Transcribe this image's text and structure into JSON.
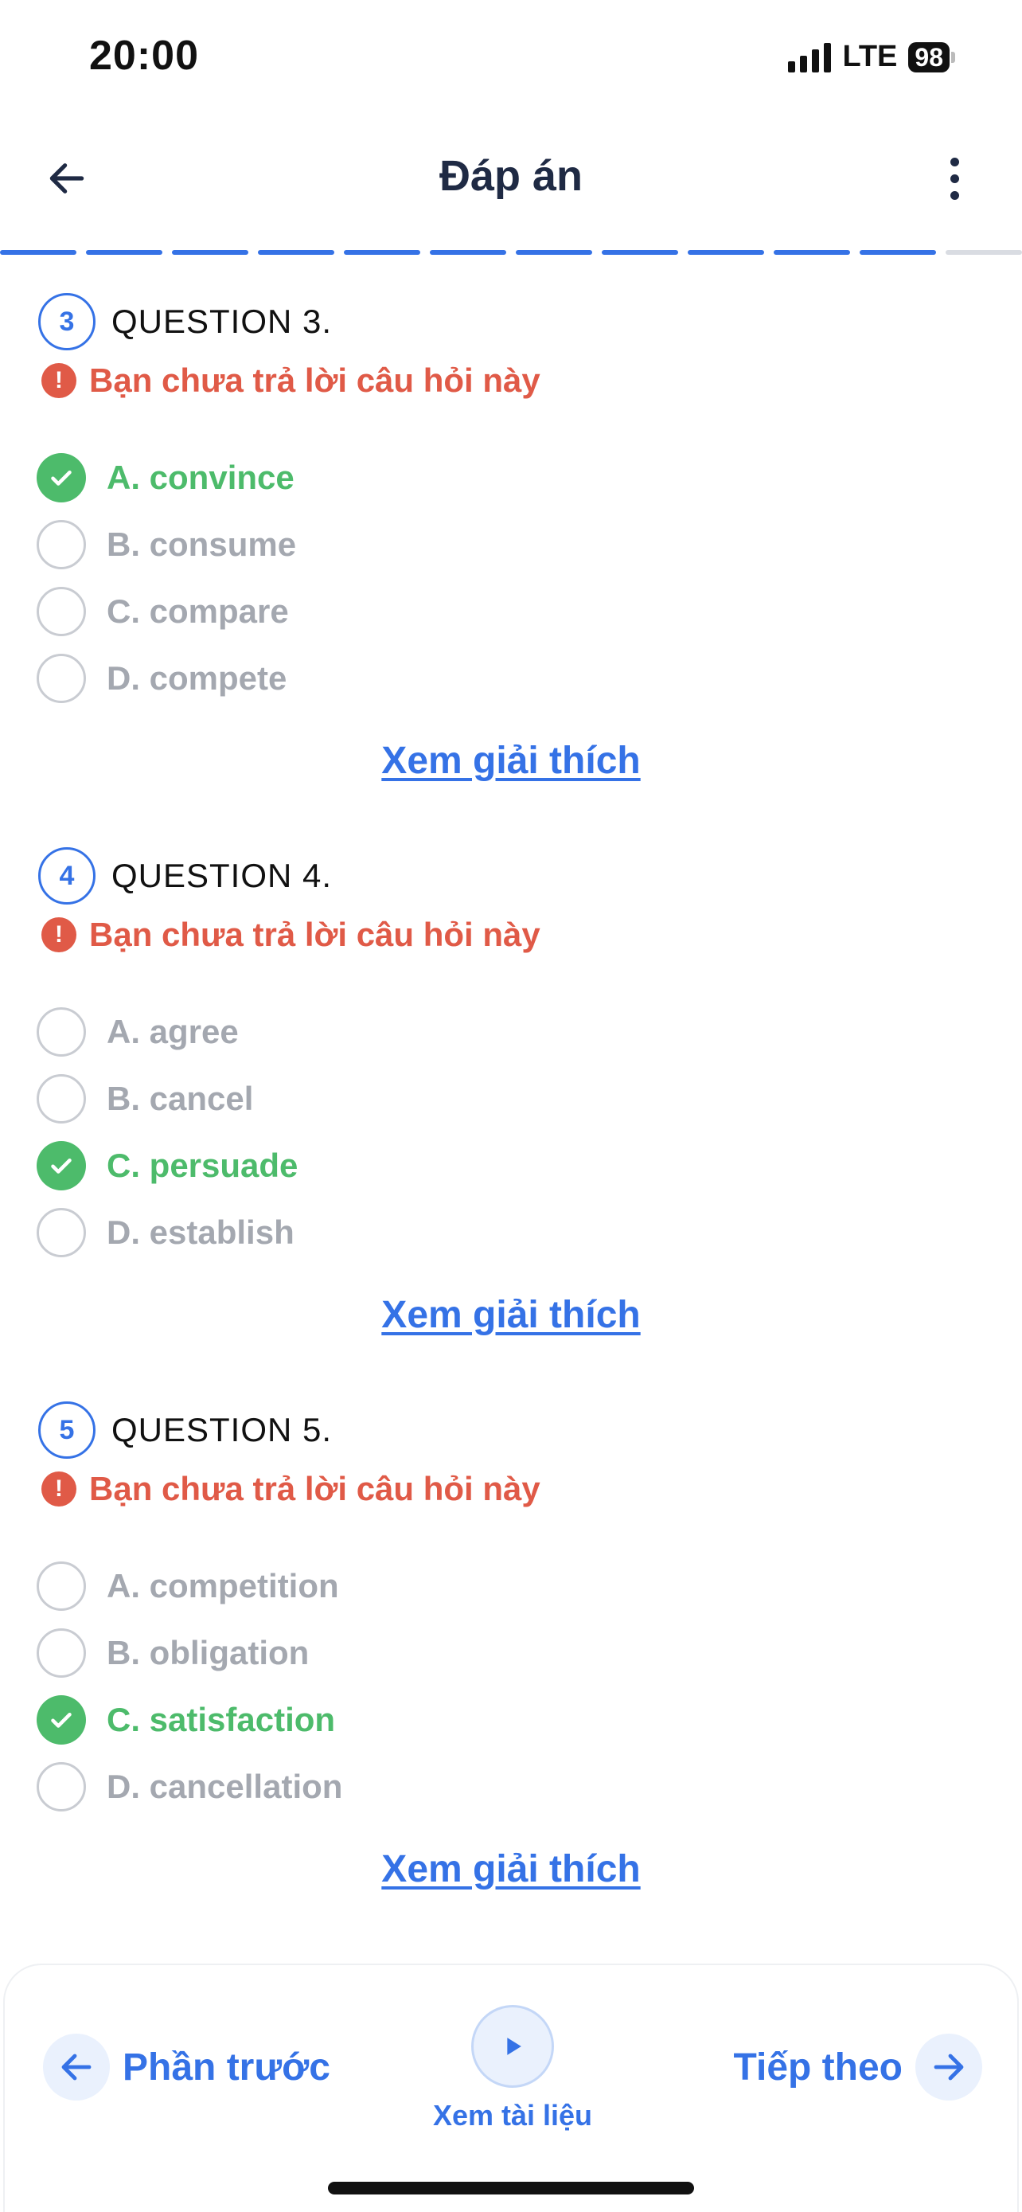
{
  "status_bar": {
    "time": "20:00",
    "network": "LTE",
    "battery": "98"
  },
  "header": {
    "title": "Đáp án"
  },
  "progress": {
    "total_segments": 12,
    "completed_segments": 11
  },
  "colors": {
    "accent": "#3572e6",
    "correct": "#4dbb6b",
    "warning": "#e05a47",
    "muted": "#a4a8b0"
  },
  "questions": [
    {
      "number": "3",
      "title": "QUESTION 3.",
      "warning": "Bạn chưa trả lời câu hỏi này",
      "options": [
        {
          "label": "A. convince",
          "correct": true
        },
        {
          "label": "B. consume",
          "correct": false
        },
        {
          "label": "C. compare",
          "correct": false
        },
        {
          "label": "D. compete",
          "correct": false
        }
      ],
      "explain_label": "Xem giải thích"
    },
    {
      "number": "4",
      "title": "QUESTION 4.",
      "warning": "Bạn chưa trả lời câu hỏi này",
      "options": [
        {
          "label": "A. agree",
          "correct": false
        },
        {
          "label": "B. cancel",
          "correct": false
        },
        {
          "label": "C. persuade",
          "correct": true
        },
        {
          "label": "D. establish",
          "correct": false
        }
      ],
      "explain_label": "Xem giải thích"
    },
    {
      "number": "5",
      "title": "QUESTION 5.",
      "warning": "Bạn chưa trả lời câu hỏi này",
      "options": [
        {
          "label": "A. competition",
          "correct": false
        },
        {
          "label": "B. obligation",
          "correct": false
        },
        {
          "label": "C. satisfaction",
          "correct": true
        },
        {
          "label": "D. cancellation",
          "correct": false
        }
      ],
      "explain_label": "Xem giải thích"
    }
  ],
  "bottom_bar": {
    "prev_label": "Phần trước",
    "next_label": "Tiếp theo",
    "docs_label": "Xem tài liệu"
  }
}
